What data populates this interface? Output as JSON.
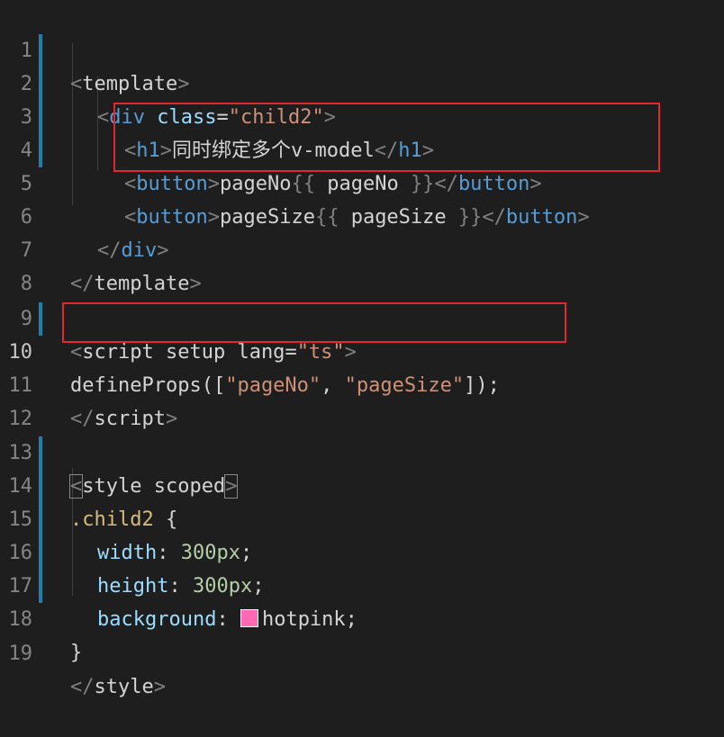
{
  "editor": {
    "lines": [
      {
        "n": "1"
      },
      {
        "n": "2"
      },
      {
        "n": "3"
      },
      {
        "n": "4"
      },
      {
        "n": "5"
      },
      {
        "n": "6"
      },
      {
        "n": "7"
      },
      {
        "n": "8"
      },
      {
        "n": "9"
      },
      {
        "n": "10"
      },
      {
        "n": "11"
      },
      {
        "n": "12"
      },
      {
        "n": "13"
      },
      {
        "n": "14"
      },
      {
        "n": "15"
      },
      {
        "n": "16"
      },
      {
        "n": "17"
      },
      {
        "n": "18"
      },
      {
        "n": "19"
      }
    ],
    "tok": {
      "lt": "<",
      "gt": ">",
      "ltslash": "</",
      "template": "template",
      "div": "div",
      "class_attr": " class",
      "eq": "=",
      "child2_str": "\"child2\"",
      "h1": "h1",
      "h1_text": "同时绑定多个v-model",
      "button": "button",
      "pageNo_text": "pageNo",
      "open_mustache": "{{",
      "pageNo_expr": " pageNo ",
      "close_mustache": "}}",
      "pageSize_text": "pageSize",
      "pageSize_expr": " pageSize ",
      "script": "script",
      "setup_lang": " setup lang",
      "ts_str": "\"ts\"",
      "defineProps": "defineProps",
      "paren_open": "([",
      "pageNo_str": "\"pageNo\"",
      "comma": ", ",
      "pageSize_str": "\"pageSize\"",
      "paren_close": "]);",
      "style": "style",
      "scoped": " scoped",
      "child2_sel": ".child2 ",
      "brace_open": "{",
      "brace_close": "}",
      "width": "width",
      "height": "height",
      "background": "background",
      "colon": ": ",
      "px300": "300px",
      "semi": ";",
      "hotpink": "hotpink"
    },
    "colors": {
      "swatch": "#ff69b4",
      "box": "#e0282e"
    }
  }
}
